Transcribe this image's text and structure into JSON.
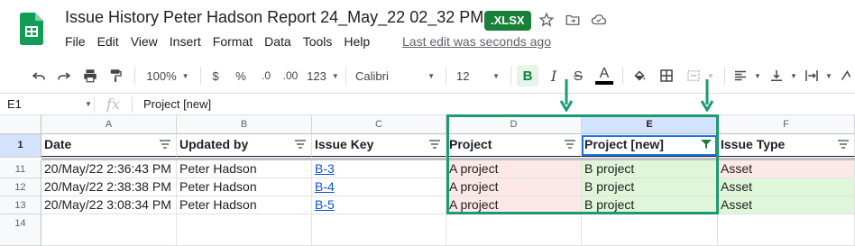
{
  "app": {
    "title": "Issue History Peter Hadson Report 24_May_22 02_32 PM",
    "badge": ".XLSX",
    "last_edit": "Last edit was seconds ago"
  },
  "menu": [
    "File",
    "Edit",
    "View",
    "Insert",
    "Format",
    "Data",
    "Tools",
    "Help"
  ],
  "toolbar": {
    "zoom": "100%",
    "currency": "$",
    "percent": "%",
    "dec_decrease": ".0",
    "dec_increase": ".00",
    "more_formats": "123",
    "font": "Calibri",
    "font_size": "12",
    "bold": "B",
    "italic": "I",
    "strike": "S",
    "text_color": "A"
  },
  "formula_bar": {
    "cell_ref": "E1",
    "fx": "fx",
    "value": "Project [new]"
  },
  "columns": [
    "A",
    "B",
    "C",
    "D",
    "E",
    "F"
  ],
  "selected_column": "E",
  "header_row": {
    "row_number": "1",
    "cells": [
      "Date",
      "Updated by",
      "Issue Key",
      "Project",
      "Project [new]",
      "Issue Type"
    ]
  },
  "rows": [
    {
      "row_number": "11",
      "cells": [
        "20/May/22 2:36:43 PM",
        "Peter Hadson",
        "B-3",
        "A project",
        "B project",
        "Asset"
      ]
    },
    {
      "row_number": "12",
      "cells": [
        "20/May/22 2:38:38 PM",
        "Peter Hadson",
        "B-4",
        "A project",
        "B project",
        "Asset"
      ]
    },
    {
      "row_number": "13",
      "cells": [
        "20/May/22 3:08:34 PM",
        "Peter Hadson",
        "B-5",
        "A project",
        "B project",
        "Asset"
      ]
    },
    {
      "row_number": "14",
      "cells": [
        "",
        "",
        "",
        "",
        "",
        ""
      ]
    }
  ],
  "colors": {
    "accent_green": "#188038",
    "highlight_green": "#1d9a71",
    "pink_fill": "#fce8e6",
    "green_fill": "#dff7d8",
    "link": "#1155cc"
  }
}
